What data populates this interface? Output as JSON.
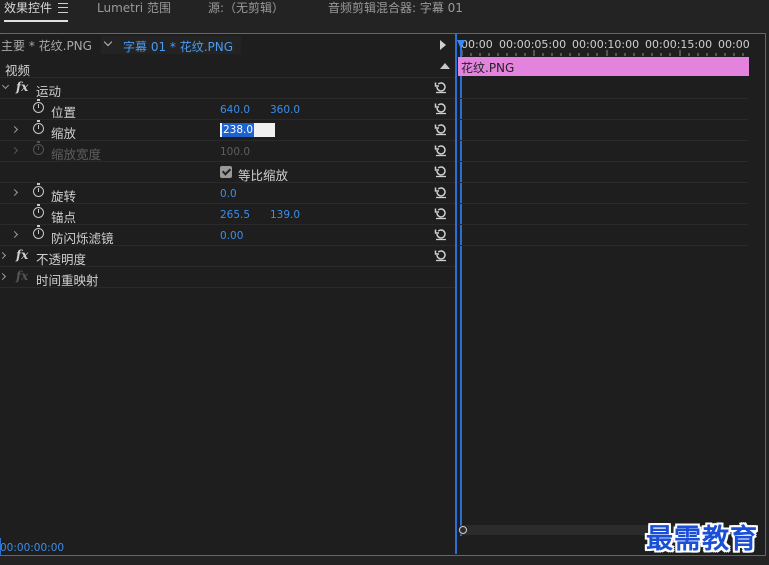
{
  "tabs": [
    {
      "label": "效果控件",
      "active": true
    },
    {
      "label": "Lumetri 范围",
      "active": false
    },
    {
      "label": "源:（无剪辑）",
      "active": false
    },
    {
      "label": "音频剪辑混合器: 字幕 01",
      "active": false
    }
  ],
  "clip_header": {
    "master": "主要 * 花纹.PNG",
    "clip": "字幕 01 * 花纹.PNG"
  },
  "section": {
    "label": "视频"
  },
  "effects": {
    "motion": {
      "label": "运动"
    },
    "position": {
      "label": "位置",
      "x": "640.0",
      "y": "360.0"
    },
    "scale": {
      "label": "缩放",
      "value": "238.0"
    },
    "scale_width": {
      "label": "缩放宽度",
      "value": "100.0"
    },
    "uniform_scale": {
      "label": "等比缩放",
      "checked": true
    },
    "rotation": {
      "label": "旋转",
      "value": "0.0"
    },
    "anchor": {
      "label": "锚点",
      "x": "265.5",
      "y": "139.0"
    },
    "anti_flicker": {
      "label": "防闪烁滤镜",
      "value": "0.00"
    },
    "opacity": {
      "label": "不透明度"
    },
    "time_remap": {
      "label": "时间重映射"
    }
  },
  "timeline": {
    "ruler": [
      "00:00",
      "00:00:05:00",
      "00:00:10:00",
      "00:00:15:00",
      "00:00"
    ],
    "clip_name": "花纹.PNG",
    "clip_color": "#e383de"
  },
  "footer": {
    "timecode": "00:00:00:00"
  },
  "watermark": "最需教育",
  "colors": {
    "accent": "#2b6fd6",
    "value_blue": "#3d8ee8"
  }
}
